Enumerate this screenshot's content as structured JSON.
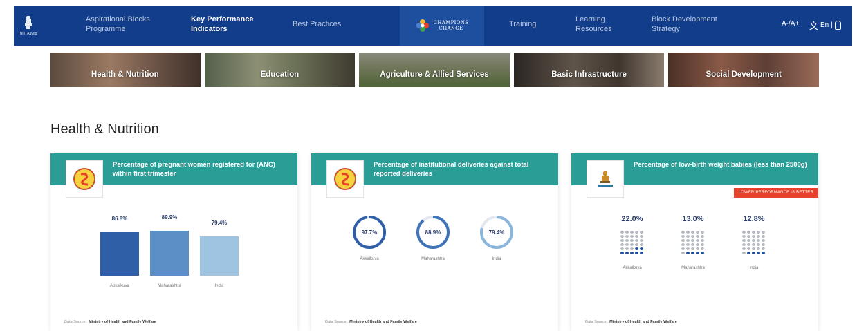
{
  "nav": {
    "logo_text": "NITI Aayog",
    "items": [
      {
        "label": "Aspirational Blocks\nProgramme"
      },
      {
        "label": "Key Performance\nIndicators"
      },
      {
        "label": "Best Practices"
      },
      {
        "label": "Training"
      },
      {
        "label": "Learning\nResources"
      },
      {
        "label": "Block Development\nStrategy"
      }
    ],
    "champions_line1": "CHAMPIONS",
    "champions_line2": "CHANGE",
    "font_size": "A-/A+",
    "language": "En"
  },
  "themes": [
    {
      "label": "Health & Nutrition"
    },
    {
      "label": "Education"
    },
    {
      "label": "Agriculture & Allied Services"
    },
    {
      "label": "Basic Infrastructure"
    },
    {
      "label": "Social Development"
    }
  ],
  "section": {
    "title": "Health & Nutrition"
  },
  "cards": [
    {
      "title": "Percentage of pregnant women registered for (ANC) within first trimester",
      "source_label": "Data Source :",
      "source_value": "Ministry of Health and Family Welfare",
      "chart_data": {
        "type": "bar",
        "categories": [
          "Abkalkuva",
          "Maharashtra",
          "India"
        ],
        "values": [
          86.8,
          89.9,
          79.4
        ],
        "value_labels": [
          "86.8%",
          "89.9%",
          "79.4%"
        ],
        "colors": [
          "#2f5fa7",
          "#5b8fc6",
          "#9fc4e2"
        ]
      }
    },
    {
      "title": "Percentage of institutional deliveries against total reported deliveries",
      "source_label": "Data Source :",
      "source_value": "Ministry of Health and Family Welfare",
      "chart_data": {
        "type": "pie",
        "categories": [
          "Akkalkuva",
          "Maharashtra",
          "India"
        ],
        "values": [
          97.7,
          88.9,
          79.4
        ],
        "value_labels": [
          "97.7%",
          "88.9%",
          "79.4%"
        ],
        "colors": [
          "#2f5fa7",
          "#3f74b8",
          "#8ab6dc"
        ]
      }
    },
    {
      "title": "Percentage of low-birth weight babies (less than 2500g)",
      "badge": "LOWER PERFORMANCE IS BETTER",
      "source_label": "Data Source :",
      "source_value": "Ministry of Health and Family Welfare",
      "chart_data": {
        "type": "scatter",
        "categories": [
          "Akkalkuva",
          "Maharashtra",
          "India"
        ],
        "values": [
          22.0,
          13.0,
          12.8
        ],
        "value_labels": [
          "22.0%",
          "13.0%",
          "12.8%"
        ]
      }
    }
  ]
}
